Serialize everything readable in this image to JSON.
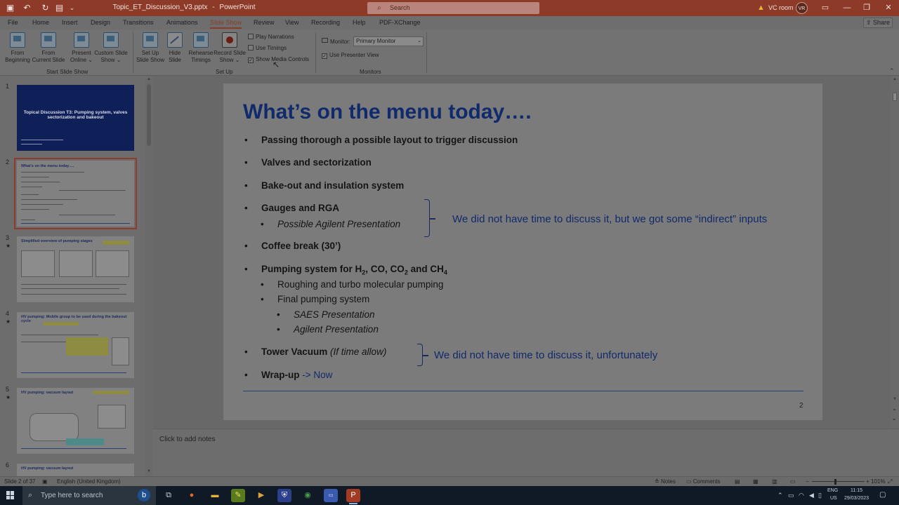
{
  "window": {
    "doc_title": "Topic_ET_Discussion_V3.pptx",
    "app_sep": "-",
    "app_name": "PowerPoint",
    "search_placeholder": "Search",
    "account_name": "VC room",
    "avatar_initials": "VR"
  },
  "ribbon_tabs": [
    "File",
    "Home",
    "Insert",
    "Design",
    "Transitions",
    "Animations",
    "Slide Show",
    "Review",
    "View",
    "Recording",
    "Help",
    "PDF-XChange"
  ],
  "active_tab": "Slide Show",
  "share_label": "Share",
  "ribbon": {
    "start_group": {
      "label": "Start Slide Show",
      "from_beginning": [
        "From",
        "Beginning"
      ],
      "from_current": [
        "From",
        "Current Slide"
      ],
      "present_online": [
        "Present",
        "Online ⌄"
      ],
      "custom_show": [
        "Custom Slide",
        "Show ⌄"
      ]
    },
    "setup_group": {
      "label": "Set Up",
      "setup_show": [
        "Set Up",
        "Slide Show"
      ],
      "hide_slide": [
        "Hide",
        "Slide"
      ],
      "rehearse": [
        "Rehearse",
        "Timings"
      ],
      "record": [
        "Record Slide",
        "Show ⌄"
      ],
      "play_narrations": "Play Narrations",
      "use_timings": "Use Timings",
      "show_media_controls": "Show Media Controls"
    },
    "monitors_group": {
      "label": "Monitors",
      "monitor_label": "Monitor:",
      "monitor_value": "Primary Monitor",
      "presenter_view": "Use Presenter View"
    }
  },
  "thumbnails": {
    "numbers": [
      "1",
      "2",
      "3",
      "4",
      "5",
      "6"
    ],
    "slide1_title": "Topical Discussion T3: Pumping system, valves sectorization and bakeout",
    "slide2_title": "What's on the menu today….",
    "slide3_title": "Simplified overview of pumping stages",
    "slide4_title": "HV pumping: Mobile group to be used during the bakeout cycle",
    "slide5_title": "HV pumping: vacuum layout",
    "slide6_title": "HV pumping: vacuum layout",
    "selected": 2
  },
  "slide": {
    "title": "What’s on the menu today….",
    "items": {
      "b1": "Passing thorough a possible layout to trigger discussion",
      "b2": "Valves and sectorization",
      "b3": "Bake-out and insulation system",
      "b4": "Gauges and RGA",
      "b4a": "Possible Agilent Presentation",
      "b5": "Coffee break (30’)",
      "b6_pre": "Pumping system for H",
      "b6_sub1": "2",
      "b6_mid1": ", CO, CO",
      "b6_sub2": "2",
      "b6_mid2": " and CH",
      "b6_sub3": "4",
      "b6a": "Roughing and turbo molecular pumping",
      "b6b": "Final pumping system",
      "b6b1": "SAES Presentation",
      "b6b2": "Agilent Presentation",
      "b7": "Tower Vacuum",
      "b7_note": "(If time allow)",
      "b8": "Wrap-up",
      "b8_arrow": "->",
      "b8_now": "Now"
    },
    "note_gauges": "We did not have time to discuss it, but we got some “indirect” inputs",
    "note_tower": "We did not have time to discuss it, unfortunately",
    "bullet_l1": "•",
    "bullet_l2": "•",
    "page_number": "2"
  },
  "notes_placeholder": "Click to add notes",
  "status": {
    "slide_pos": "Slide 2 of 37",
    "language": "English (United Kingdom)",
    "notes": "Notes",
    "comments": "Comments",
    "zoom": "101%"
  },
  "taskbar": {
    "search_placeholder": "Type here to search",
    "lang": "ENG",
    "region": "US",
    "time": "11:15",
    "date": "29/03/2023"
  },
  "colors": {
    "titlebar": "#8d3b28",
    "slide_title": "#102a6b",
    "accent": "#8d3b28"
  }
}
